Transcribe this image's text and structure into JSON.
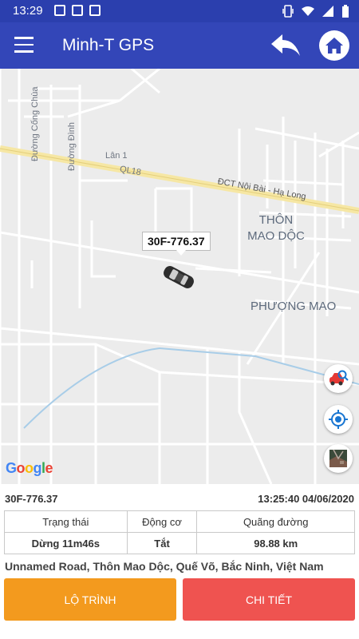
{
  "status_bar": {
    "time": "13:29"
  },
  "app_bar": {
    "title": "Minh-T GPS"
  },
  "map": {
    "labels": {
      "street1": "Đường Cống Chùa",
      "street2": "Đường Đình",
      "lane": "Lân 1",
      "highway_code": "QL18",
      "highway": "ĐCT Nội Bài - Hạ Long",
      "place1": "THÔN\nMAO DỘC",
      "place2": "PHƯỢNG MAO"
    },
    "vehicle_label": "30F-776.37",
    "attribution": "Google"
  },
  "info": {
    "plate": "30F-776.37",
    "timestamp": "13:25:40 04/06/2020",
    "headers": [
      "Trạng thái",
      "Động cơ",
      "Quãng đường"
    ],
    "values": [
      "Dừng 11m46s",
      "Tắt",
      "98.88 km"
    ],
    "address": "Unnamed Road, Thôn Mao Dộc, Quế Võ, Bắc Ninh, Việt Nam"
  },
  "buttons": {
    "route": "LỘ TRÌNH",
    "detail": "CHI TIẾT"
  },
  "colors": {
    "app_bar": "#3346b8",
    "route_button": "#f39a1e",
    "detail_button": "#ef5350",
    "highway": "#f6e7a4",
    "car": "#2d2d2d"
  }
}
